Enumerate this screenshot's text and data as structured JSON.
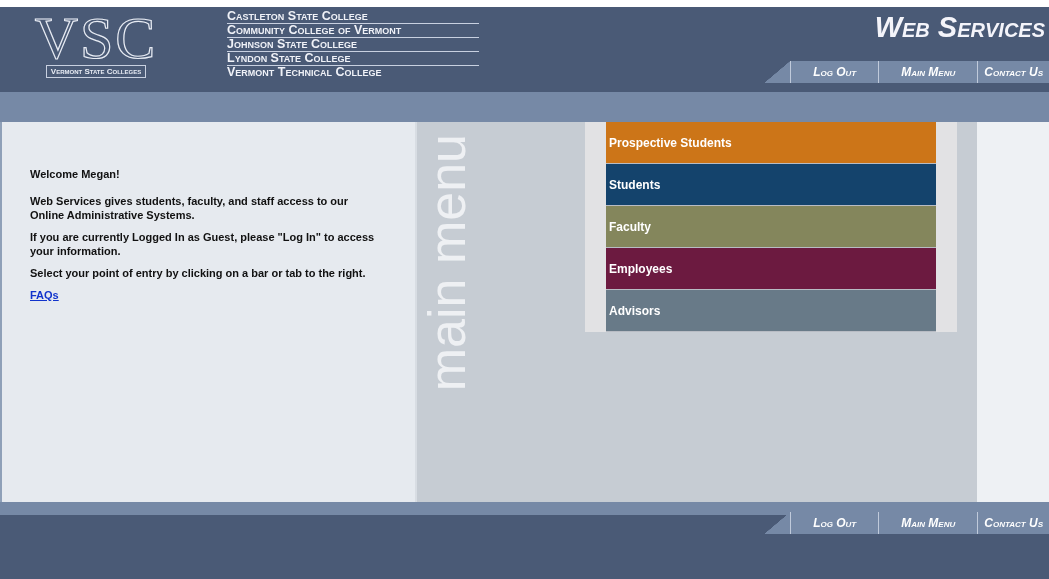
{
  "header": {
    "logo": {
      "letters": "VSC",
      "caption": "Vermont State Colleges"
    },
    "colleges": [
      "Castleton State College",
      "Community College of Vermont",
      "Johnson State College",
      "Lyndon State College",
      "Vermont Technical College"
    ],
    "title": "Web Services",
    "nav": [
      "Log Out",
      "Main Menu",
      "Contact Us"
    ]
  },
  "welcome": {
    "greeting": "Welcome Megan!",
    "paragraphs": [
      "Web Services gives students, faculty, and staff access to our Online Administrative Systems.",
      "If you are currently Logged In as Guest, please \"Log In\" to access your information.",
      "Select your point of entry by clicking on a bar or tab to the right."
    ],
    "link": "FAQs"
  },
  "menu": {
    "watermark": "main menu",
    "items": [
      {
        "label": "Prospective Students",
        "color": "#cc7518"
      },
      {
        "label": "Students",
        "color": "#14436c"
      },
      {
        "label": "Faculty",
        "color": "#84865c"
      },
      {
        "label": "Employees",
        "color": "#6c1a40"
      },
      {
        "label": "Advisors",
        "color": "#687a88"
      }
    ]
  },
  "footer": {
    "nav": [
      "Log Out",
      "Main Menu",
      "Contact Us"
    ]
  }
}
